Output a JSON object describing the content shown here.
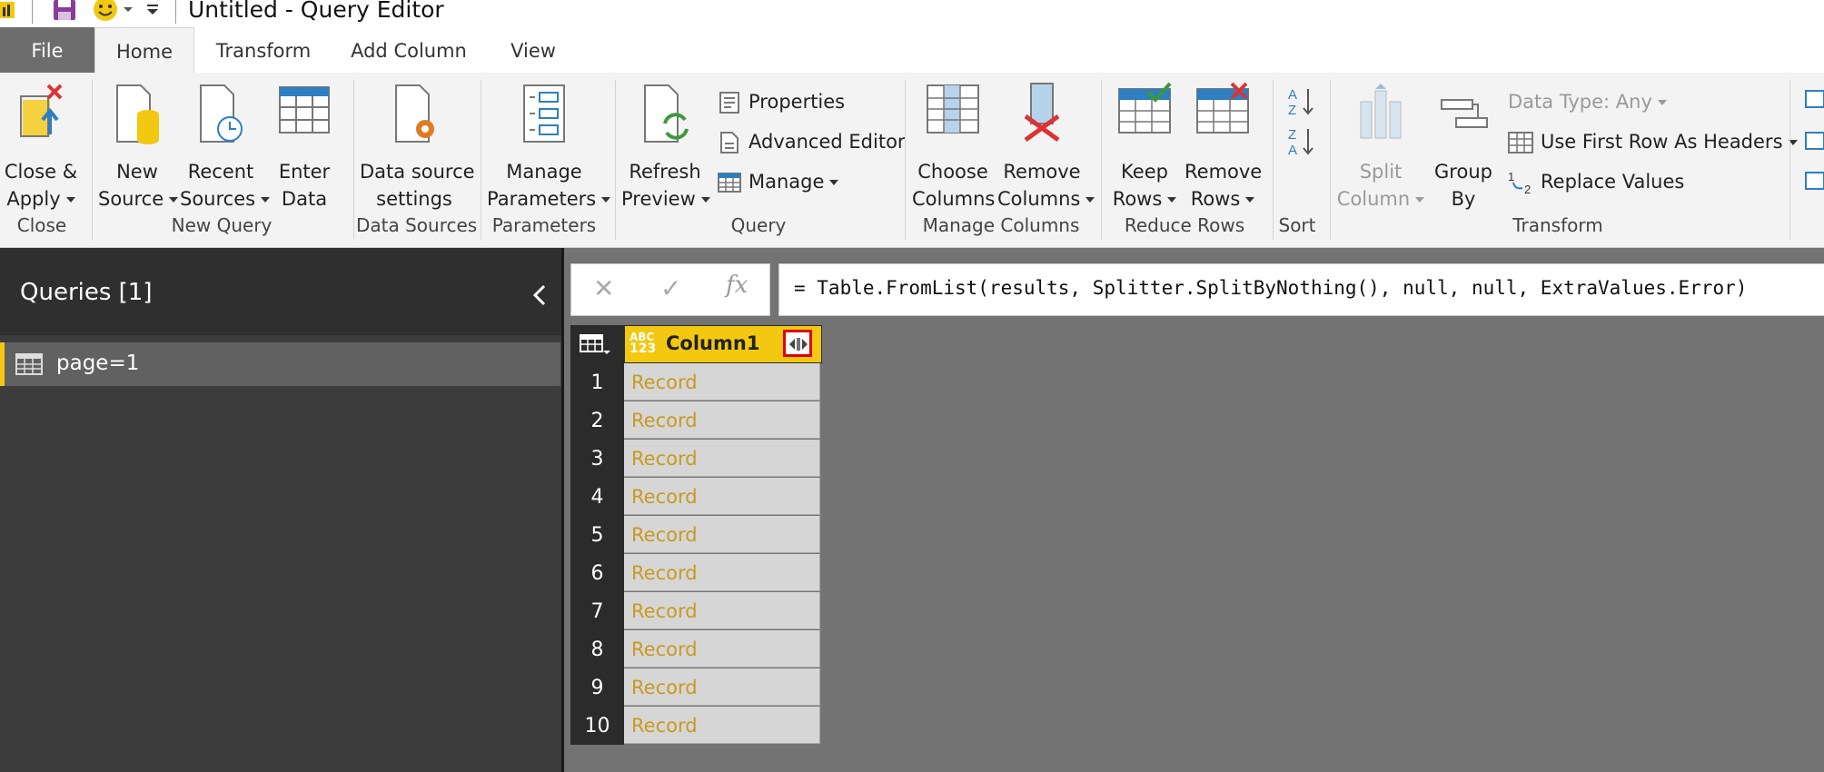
{
  "window": {
    "title": "Untitled - Query Editor"
  },
  "tabs": [
    {
      "label": "File",
      "name": "tab-file"
    },
    {
      "label": "Home",
      "name": "tab-home"
    },
    {
      "label": "Transform",
      "name": "tab-transform"
    },
    {
      "label": "Add Column",
      "name": "tab-add-column"
    },
    {
      "label": "View",
      "name": "tab-view"
    }
  ],
  "ribbon": {
    "close": {
      "btn_line1": "Close &",
      "btn_line2": "Apply",
      "group": "Close"
    },
    "new_query": {
      "new_source_1": "New",
      "new_source_2": "Source",
      "recent_1": "Recent",
      "recent_2": "Sources",
      "enter_1": "Enter",
      "enter_2": "Data",
      "group": "New Query"
    },
    "data_sources": {
      "btn_1": "Data source",
      "btn_2": "settings",
      "group": "Data Sources"
    },
    "parameters": {
      "btn_1": "Manage",
      "btn_2": "Parameters",
      "group": "Parameters"
    },
    "query": {
      "refresh_1": "Refresh",
      "refresh_2": "Preview",
      "properties": "Properties",
      "advanced_editor": "Advanced Editor",
      "manage": "Manage",
      "group": "Query"
    },
    "manage_columns": {
      "choose_1": "Choose",
      "choose_2": "Columns",
      "remove_1": "Remove",
      "remove_2": "Columns",
      "group": "Manage Columns"
    },
    "reduce_rows": {
      "keep_1": "Keep",
      "keep_2": "Rows",
      "remove_1": "Remove",
      "remove_2": "Rows",
      "group": "Reduce Rows"
    },
    "sort": {
      "asc": "A Z",
      "desc": "Z A",
      "group": "Sort"
    },
    "transform": {
      "split_1": "Split",
      "split_2": "Column",
      "group_1": "Group",
      "group_2": "By",
      "data_type": "Data Type: Any",
      "first_row": "Use First Row As Headers",
      "replace": "Replace Values",
      "group": "Transform"
    }
  },
  "queries": {
    "header": "Queries [1]",
    "items": [
      {
        "label": "page=1"
      }
    ]
  },
  "formula_bar": {
    "cancel": "✕",
    "confirm": "✓",
    "fx": "fx",
    "formula": "= Table.FromList(results, Splitter.SplitByNothing(), null, null, ExtraValues.Error)"
  },
  "grid": {
    "type_top": "ABC",
    "type_bottom": "123",
    "column": "Column1",
    "rows": [
      {
        "n": "1",
        "v": "Record"
      },
      {
        "n": "2",
        "v": "Record"
      },
      {
        "n": "3",
        "v": "Record"
      },
      {
        "n": "4",
        "v": "Record"
      },
      {
        "n": "5",
        "v": "Record"
      },
      {
        "n": "6",
        "v": "Record"
      },
      {
        "n": "7",
        "v": "Record"
      },
      {
        "n": "8",
        "v": "Record"
      },
      {
        "n": "9",
        "v": "Record"
      },
      {
        "n": "10",
        "v": "Record"
      }
    ]
  },
  "colors": {
    "accent": "#f2c811",
    "record_text": "#c89a20",
    "highlight_box": "#e00000"
  }
}
